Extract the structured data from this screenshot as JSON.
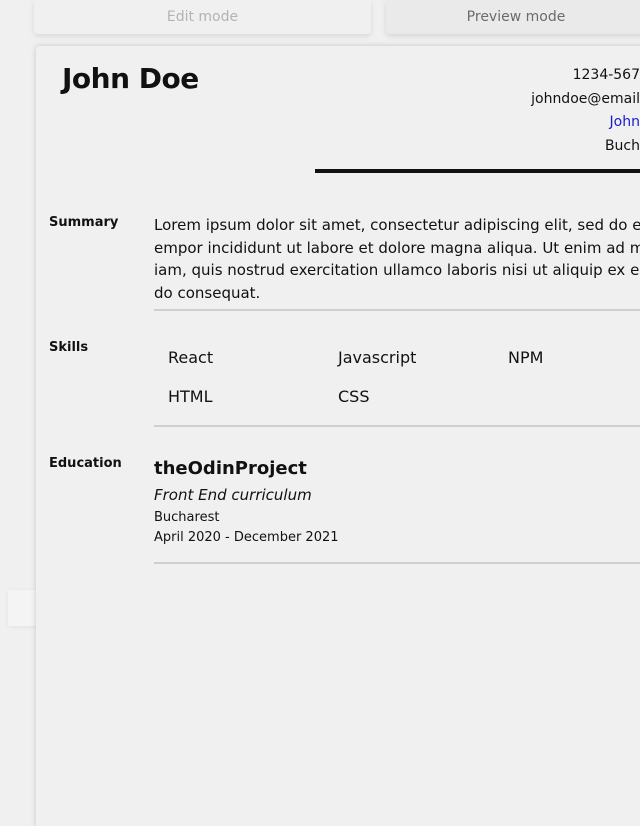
{
  "tabs": {
    "edit_label": "Edit mode",
    "preview_label": "Preview mode"
  },
  "resume": {
    "name": "John Doe",
    "contact": {
      "phone": "1234-567",
      "email": "johndoe@email",
      "link": "John",
      "location": "Buch"
    },
    "summary": {
      "label": "Summary",
      "text": "Lorem ipsum dolor sit amet, consectetur adipiscing elit, sed do ei\nempor incididunt ut labore et dolore magna aliqua. Ut enim ad m\niam, quis nostrud exercitation ullamco laboris nisi ut aliquip ex ea\ndo consequat."
    },
    "skills": {
      "label": "Skills",
      "items": [
        "React",
        "Javascript",
        "NPM",
        "HTML",
        "CSS"
      ]
    },
    "education": {
      "label": "Education",
      "school": "theOdinProject",
      "degree": "Front End curriculum",
      "location": "Bucharest",
      "dates": "April 2020 - December 2021"
    }
  },
  "colors": {
    "background": "#f0f0f0",
    "text": "#111111",
    "link": "#1a1acc",
    "muted_tab_text": "#b3b3b3",
    "rule": "#cfcfcf"
  }
}
